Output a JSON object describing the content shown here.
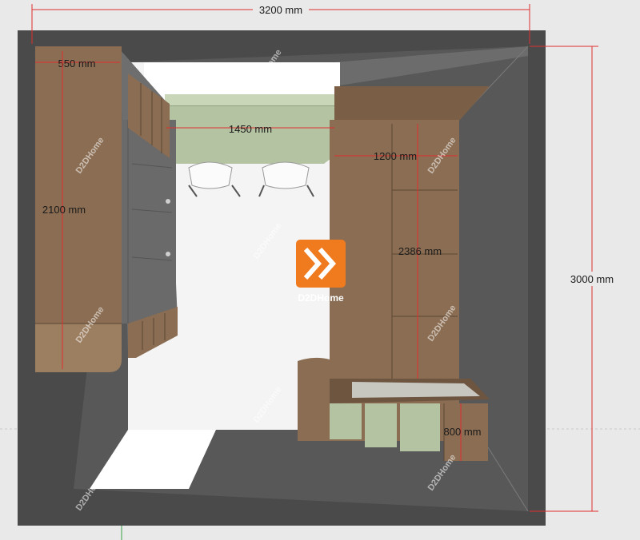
{
  "dimensions": {
    "overall_width": "3200 mm",
    "overall_depth": "3000 mm",
    "left_cabinet_depth": "550 mm",
    "left_cabinet_height": "2100 mm",
    "window_bench_width": "1450 mm",
    "right_wardrobe_width": "1200 mm",
    "right_wardrobe_height": "2386 mm",
    "desk_height": "800 mm"
  },
  "logo": {
    "text": "D2DHome",
    "color": "#f07a1e"
  },
  "watermarks": [
    "D2DHome",
    "D2DHome",
    "D2DHome",
    "D2DHome",
    "D2DHome",
    "D2DHome",
    "D2DHome",
    "D2DHome",
    "D2DHome"
  ],
  "colors": {
    "wall": "#4a4a4a",
    "floor": "#fafafa",
    "wood": "#8a6d52",
    "sage": "#b4c4a2",
    "dimension": "#e03030"
  }
}
